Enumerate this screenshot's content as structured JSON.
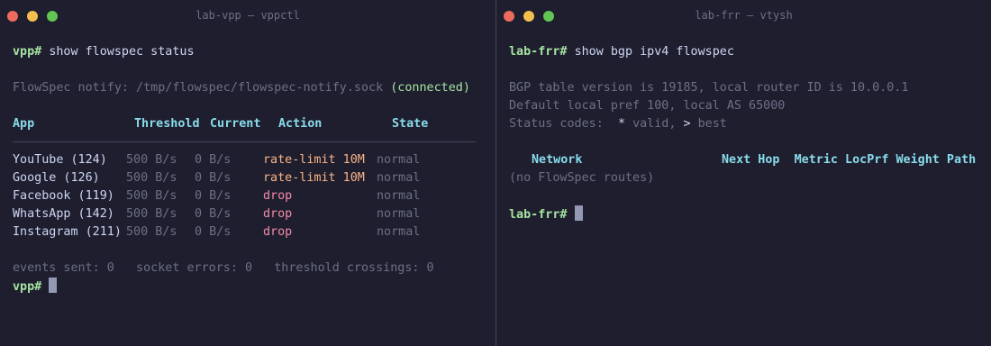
{
  "left": {
    "title": "lab-vpp — vppctl",
    "prompt": "vpp#",
    "command": "show flowspec status",
    "notify_label": "FlowSpec notify: /tmp/flowspec/flowspec-notify.sock",
    "notify_status": "(connected)",
    "table": {
      "headers": [
        "App",
        "Threshold",
        "Current",
        "Action",
        "State"
      ],
      "rows": [
        {
          "app": "YouTube (124)",
          "threshold": "500 B/s",
          "current": "0 B/s",
          "action": "rate-limit 10M",
          "state": "normal"
        },
        {
          "app": "Google (126)",
          "threshold": "500 B/s",
          "current": "0 B/s",
          "action": "rate-limit 10M",
          "state": "normal"
        },
        {
          "app": "Facebook (119)",
          "threshold": "500 B/s",
          "current": "0 B/s",
          "action": "drop",
          "state": "normal"
        },
        {
          "app": "WhatsApp (142)",
          "threshold": "500 B/s",
          "current": "0 B/s",
          "action": "drop",
          "state": "normal"
        },
        {
          "app": "Instagram (211)",
          "threshold": "500 B/s",
          "current": "0 B/s",
          "action": "drop",
          "state": "normal"
        }
      ]
    },
    "stats": "events sent: 0   socket errors: 0   threshold crossings: 0",
    "prompt2": "vpp#"
  },
  "right": {
    "title": "lab-frr — vtysh",
    "prompt": "lab-frr#",
    "command": "show bgp ipv4 flowspec",
    "info_lines": [
      "BGP table version is 19185, local router ID is 10.0.0.1",
      "Default local pref 100, local AS 65000"
    ],
    "status_label": "Status codes:",
    "status_codes": [
      {
        "symbol": "*",
        "desc": "valid,"
      },
      {
        "symbol": ">",
        "desc": "best"
      }
    ],
    "headers": {
      "network": "Network",
      "rest": "Next Hop  Metric LocPrf Weight Path"
    },
    "empty_message": "(no FlowSpec routes)",
    "prompt2": "lab-frr#"
  },
  "colors": {
    "background": "#1e1e2e",
    "prompt": "#a6e3a1",
    "header": "#89dceb",
    "rate_limit": "#fab387",
    "drop": "#f38ba8",
    "dim": "#6c7086"
  }
}
